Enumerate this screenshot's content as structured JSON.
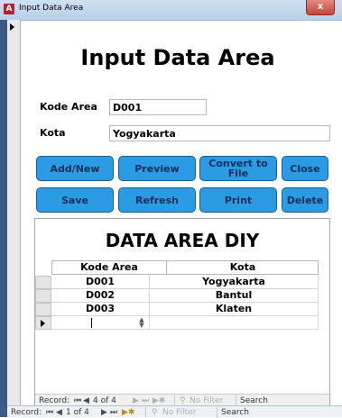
{
  "window": {
    "title": "Input Data Area",
    "app_icon_letter": "A",
    "close_glyph": "x"
  },
  "form": {
    "header": "Input Data Area",
    "fields": {
      "kode_area": {
        "label": "Kode Area",
        "value": "D001"
      },
      "kota": {
        "label": "Kota",
        "value": "Yogyakarta"
      }
    },
    "buttons": {
      "add_new": "Add/New",
      "preview": "Preview",
      "convert": "Convert to File",
      "close": "Close",
      "save": "Save",
      "refresh": "Refresh",
      "print": "Print",
      "delete": "Delete"
    }
  },
  "subform": {
    "title": "DATA AREA DIY",
    "columns": [
      "Kode Area",
      "Kota"
    ],
    "rows": [
      {
        "kode": "D001",
        "kota": "Yogyakarta"
      },
      {
        "kode": "D002",
        "kota": "Bantul"
      },
      {
        "kode": "D003",
        "kota": "Klaten"
      }
    ],
    "nav": {
      "record_label": "Record:",
      "position": "4 of 4",
      "filter": "No Filter",
      "search": "Search"
    }
  },
  "main_nav": {
    "record_label": "Record:",
    "position": "1 of 4",
    "filter": "No Filter",
    "search": "Search"
  },
  "colors": {
    "button_blue": "#2b9be3",
    "button_text": "#12305a",
    "window_accent": "#3a5b86"
  }
}
